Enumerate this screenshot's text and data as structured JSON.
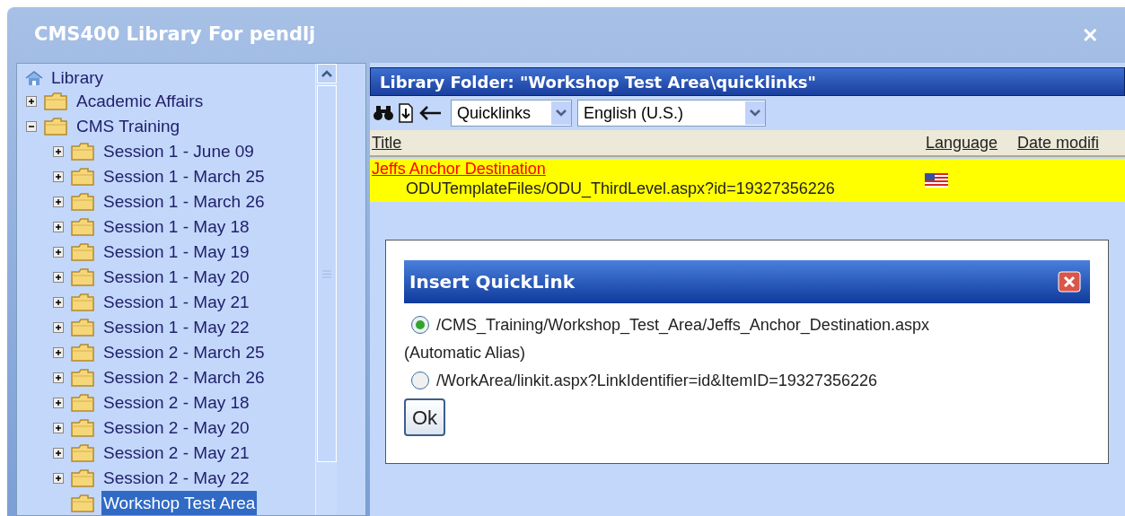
{
  "window": {
    "title": "CMS400 Library For pendlj",
    "close": "✕"
  },
  "tree": {
    "label": "Library",
    "children": [
      {
        "label": "Academic Affairs",
        "expanded": false,
        "selected": false
      },
      {
        "label": "CMS Training",
        "expanded": true,
        "selected": false,
        "children": [
          {
            "label": "Session 1 - June 09",
            "expanded": false,
            "selected": false
          },
          {
            "label": "Session 1 - March 25",
            "expanded": false,
            "selected": false
          },
          {
            "label": "Session 1 - March 26",
            "expanded": false,
            "selected": false
          },
          {
            "label": "Session 1 - May 18",
            "expanded": false,
            "selected": false
          },
          {
            "label": "Session 1 - May 19",
            "expanded": false,
            "selected": false
          },
          {
            "label": "Session 1 - May 20",
            "expanded": false,
            "selected": false
          },
          {
            "label": "Session 1 - May 21",
            "expanded": false,
            "selected": false
          },
          {
            "label": "Session 1 - May 22",
            "expanded": false,
            "selected": false
          },
          {
            "label": "Session 2 - March 25",
            "expanded": false,
            "selected": false
          },
          {
            "label": "Session 2 - March 26",
            "expanded": false,
            "selected": false
          },
          {
            "label": "Session 2 - May 18",
            "expanded": false,
            "selected": false
          },
          {
            "label": "Session 2 - May 20",
            "expanded": false,
            "selected": false
          },
          {
            "label": "Session 2 - May 21",
            "expanded": false,
            "selected": false
          },
          {
            "label": "Session 2 - May 22",
            "expanded": false,
            "selected": false
          },
          {
            "label": "Workshop Test Area",
            "selected": true
          }
        ]
      }
    ]
  },
  "folder_header": "Library Folder: \"Workshop Test Area\\quicklinks\"",
  "toolbar": {
    "type_select": "Quicklinks",
    "language_select": "English (U.S.)"
  },
  "table": {
    "columns": [
      "Title",
      "Language",
      "Date modifi"
    ],
    "rows": [
      {
        "title": "Jeffs Anchor Destination",
        "path": "ODUTemplateFiles/ODU_ThirdLevel.aspx?id=19327356226",
        "selected": true
      }
    ]
  },
  "dialog": {
    "title": "Insert QuickLink",
    "options": [
      {
        "label": "/CMS_Training/Workshop_Test_Area/Jeffs_Anchor_Destination.aspx",
        "note": "(Automatic Alias)",
        "selected": true
      },
      {
        "label": "/WorkArea/linkit.aspx?LinkIdentifier=id&ItemID=19327356226",
        "selected": false
      }
    ],
    "button": "Ok"
  }
}
